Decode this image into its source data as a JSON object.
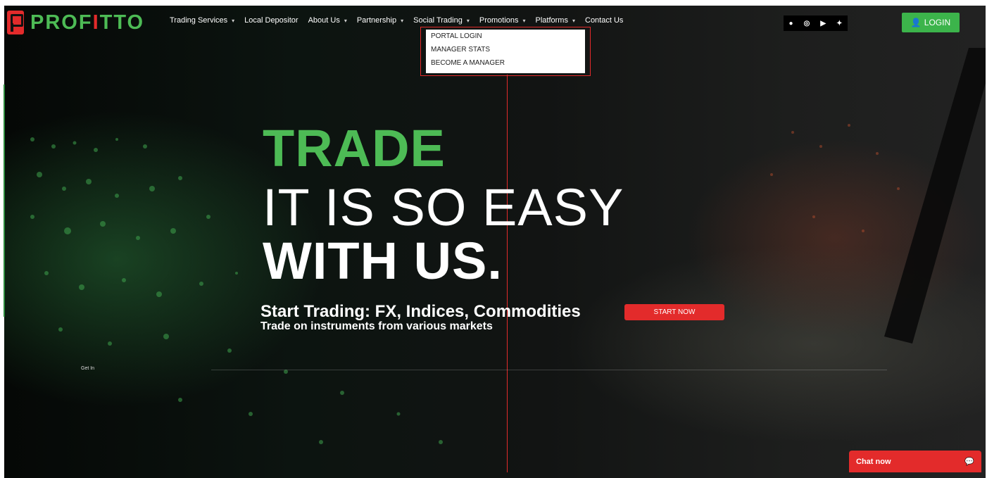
{
  "brand": {
    "name_part1": "PROF",
    "name_highlight": "I",
    "name_part2": "TTO"
  },
  "nav": [
    {
      "label": "Trading Services",
      "has_caret": true
    },
    {
      "label": "Local Depositor",
      "has_caret": false
    },
    {
      "label": "About Us",
      "has_caret": true
    },
    {
      "label": "Partnership",
      "has_caret": true
    },
    {
      "label": "Social Trading",
      "has_caret": true
    },
    {
      "label": "Promotions",
      "has_caret": true
    },
    {
      "label": "Platforms",
      "has_caret": true
    },
    {
      "label": "Contact Us",
      "has_caret": false
    }
  ],
  "dropdown": [
    "PORTAL LOGIN",
    "MANAGER STATS",
    "BECOME A MANAGER"
  ],
  "social_icons": [
    "facebook-icon",
    "instagram-icon",
    "youtube-icon",
    "twitter-icon"
  ],
  "login_label": "LOGIN",
  "hero": {
    "line1": "TRADE",
    "line2": "IT IS SO EASY",
    "line3": "WITH US.",
    "subtitle": "Start Trading: FX, Indices, Commodities",
    "subtitle2": "Trade on instruments from various markets",
    "cta": "START NOW"
  },
  "get_in": "Get In",
  "chat": {
    "label": "Chat now"
  },
  "colors": {
    "green": "#4dbb55",
    "red": "#e32b2b",
    "login_green": "#3cb44b"
  }
}
